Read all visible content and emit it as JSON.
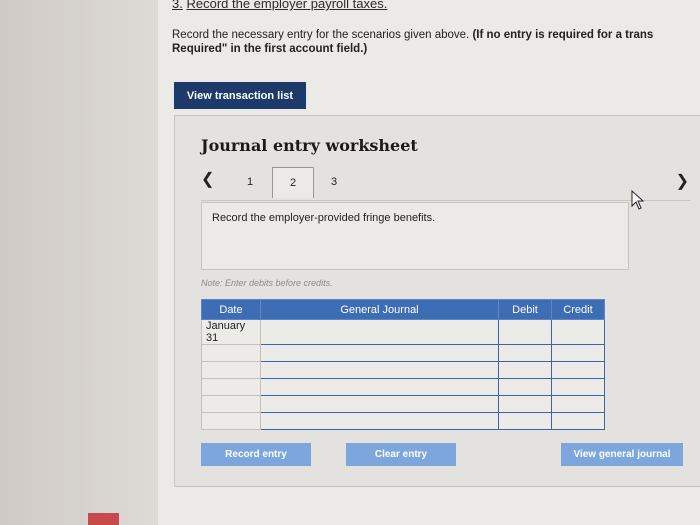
{
  "question": {
    "step_number": "3.",
    "step_title": "Record the employer payroll taxes.",
    "instructions": "Record the necessary entry for the scenarios given above.",
    "instructions_bold": "(If no entry is required for a trans",
    "instructions_line2": "Required\" in the first account field.)"
  },
  "buttons": {
    "view_transaction_list": "View transaction list",
    "record_entry": "Record entry",
    "clear_entry": "Clear entry",
    "view_general_journal": "View general journal"
  },
  "worksheet": {
    "title": "Journal entry worksheet",
    "tabs": [
      "1",
      "2",
      "3"
    ],
    "active_tab": "2",
    "prompt": "Record the employer-provided fringe benefits.",
    "note": "Note: Enter debits before credits."
  },
  "table": {
    "headers": [
      "Date",
      "General Journal",
      "Debit",
      "Credit"
    ],
    "rows": [
      [
        "January 31",
        "",
        "",
        ""
      ],
      [
        "",
        "",
        "",
        ""
      ],
      [
        "",
        "",
        "",
        ""
      ],
      [
        "",
        "",
        "",
        ""
      ],
      [
        "",
        "",
        "",
        ""
      ],
      [
        "",
        "",
        "",
        ""
      ]
    ]
  },
  "icons": {
    "prev": "chevron-left-icon",
    "next": "chevron-right-icon",
    "cursor": "cursor-icon"
  },
  "colors": {
    "header_blue": "#3d6db5",
    "primary_button": "#1d3a6b",
    "secondary_button": "#7da6dd"
  }
}
